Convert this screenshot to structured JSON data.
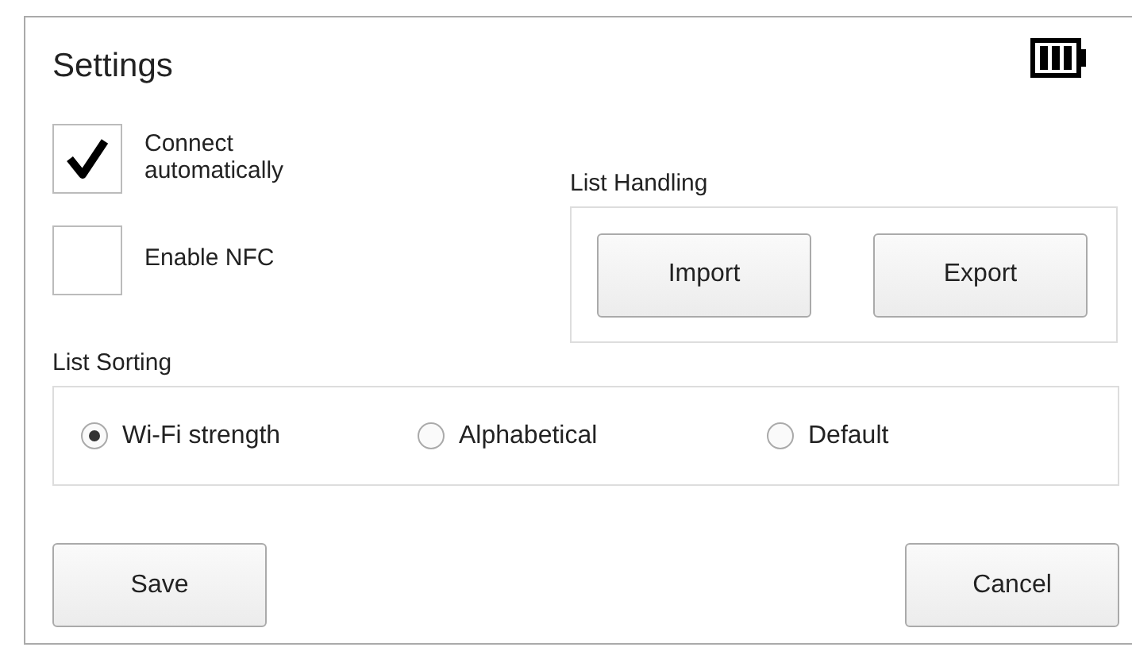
{
  "title": "Settings",
  "options": [
    {
      "label": "Connect automatically",
      "checked": true
    },
    {
      "label": "Enable NFC",
      "checked": false
    }
  ],
  "list_handling": {
    "label": "List Handling",
    "buttons": [
      "Import",
      "Export"
    ]
  },
  "list_sorting": {
    "label": "List Sorting",
    "options": [
      {
        "label": "Wi-Fi strength",
        "selected": true
      },
      {
        "label": "Alphabetical",
        "selected": false
      },
      {
        "label": "Default",
        "selected": false
      }
    ]
  },
  "buttons": [
    "Save",
    "Cancel"
  ]
}
